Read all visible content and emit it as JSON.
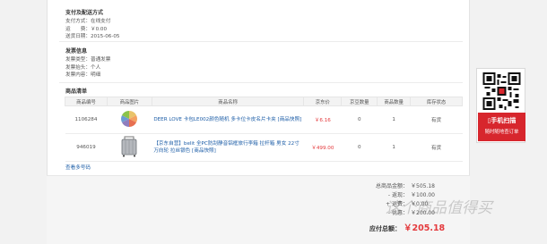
{
  "payment": {
    "title": "支付及配送方式",
    "lines": [
      {
        "label": "支付方式：",
        "value": "在线支付"
      },
      {
        "label": "运　　费：",
        "value": "￥0.00"
      },
      {
        "label": "送货日期：",
        "value": "2015-06-05"
      }
    ]
  },
  "invoice": {
    "title": "发票信息",
    "lines": [
      {
        "label": "发票类型：",
        "value": "普通发票"
      },
      {
        "label": "发票抬头：",
        "value": "个人"
      },
      {
        "label": "发票内容：",
        "value": "明细"
      }
    ]
  },
  "products": {
    "title": "商品清单",
    "headers": [
      "商品编号",
      "商品图片",
      "商品名称",
      "京东价",
      "京豆数量",
      "商品数量",
      "库存状态"
    ],
    "rows": [
      {
        "id": "1106284",
        "name": "DEER LOVE 卡包LE002颜色随机 多卡位卡皮名片卡夹 [商品快照]",
        "price": "￥6.16",
        "beans": "0",
        "qty": "1",
        "stock": "有货"
      },
      {
        "id": "946019",
        "name": "【京东自营】belit 全PC防刮静音铝框旅行李箱 拉杆箱 男女 22寸 万向轮 拉丝银色 [商品快照]",
        "price": "￥499.00",
        "beans": "0",
        "qty": "1",
        "stock": "有货"
      }
    ],
    "more_link": "查看多号码"
  },
  "summary": {
    "rows": [
      {
        "label": "总商品金额：",
        "value": "￥505.18"
      },
      {
        "label": "- 返现：",
        "value": "￥100.00"
      },
      {
        "label": "+ 运费：",
        "value": "￥0.00"
      },
      {
        "label": "- 优惠：",
        "value": "￥200.00"
      }
    ],
    "total_label": "应付总额：",
    "total_value": "￥205.18"
  },
  "watermark": "这个商品值得买",
  "side": {
    "scan_title": "手机扫描",
    "scan_sub": "随时随地查订单"
  },
  "colors": {
    "accent": "#e4393c",
    "link": "#1f5fa8",
    "scan_bg": "#d7262d"
  }
}
